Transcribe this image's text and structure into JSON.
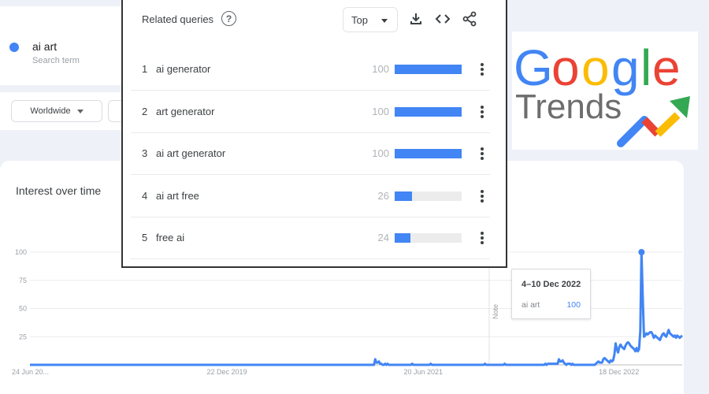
{
  "search_term": {
    "name": "ai art",
    "subtitle": "Search term",
    "color": "#4285f4"
  },
  "filters": {
    "region": "Worldwide"
  },
  "related_queries": {
    "title": "Related queries",
    "help_icon": "help-circle-icon",
    "sort_select": "Top",
    "toolbar_icons": [
      "download-icon",
      "embed-code-icon",
      "share-icon"
    ],
    "items": [
      {
        "rank": "1",
        "query": "ai generator",
        "value": 100
      },
      {
        "rank": "2",
        "query": "art generator",
        "value": 100
      },
      {
        "rank": "3",
        "query": "ai art generator",
        "value": 100
      },
      {
        "rank": "4",
        "query": "ai art free",
        "value": 26
      },
      {
        "rank": "5",
        "query": "free ai",
        "value": 24
      }
    ]
  },
  "logo": {
    "word1": "Google",
    "word2": "Trends"
  },
  "interest_over_time": {
    "title": "Interest over time",
    "tooltip": {
      "date": "4–10 Dec 2022",
      "term": "ai art",
      "value": "100"
    },
    "note_label": "Note"
  },
  "chart_data": {
    "type": "line",
    "title": "Interest over time",
    "xlabel": "",
    "ylabel": "",
    "ylim": [
      0,
      100
    ],
    "yticks": [
      25,
      50,
      75,
      100
    ],
    "xtick_labels": [
      "24 Jun 20...",
      "22 Dec 2019",
      "20 Jun 2021",
      "18 Dec 2022"
    ],
    "grid": true,
    "legend": "none",
    "series": [
      {
        "name": "ai art",
        "color": "#4285f4",
        "values": [
          0,
          0,
          0,
          0,
          0,
          0,
          0,
          0,
          0,
          0,
          0,
          0,
          0,
          0,
          0,
          0,
          0,
          0,
          0,
          0,
          0,
          0,
          0,
          0,
          0,
          0,
          0,
          0,
          0,
          0,
          0,
          0,
          0,
          0,
          0,
          0,
          0,
          0,
          0,
          0,
          0,
          0,
          0,
          0,
          0,
          0,
          0,
          0,
          0,
          0,
          0,
          0,
          0,
          0,
          0,
          0,
          0,
          0,
          0,
          0,
          0,
          0,
          0,
          0,
          0,
          0,
          0,
          0,
          0,
          0,
          0,
          0,
          0,
          0,
          0,
          0,
          0,
          0,
          0,
          0,
          0,
          0,
          0,
          0,
          0,
          0,
          0,
          0,
          0,
          0,
          0,
          0,
          0,
          0,
          0,
          0,
          0,
          0,
          0,
          0,
          0,
          0,
          0,
          0,
          0,
          0,
          0,
          0,
          0,
          0,
          0,
          0,
          0,
          0,
          0,
          0,
          0,
          0,
          0,
          0,
          0,
          0,
          0,
          0,
          0,
          0,
          0,
          0,
          0,
          0,
          0,
          0,
          0,
          0,
          0,
          0,
          0,
          0,
          0,
          0,
          0,
          0,
          0,
          0,
          0,
          0,
          0,
          0,
          0,
          0,
          0,
          0,
          0,
          0,
          0,
          0,
          0,
          0,
          0,
          0,
          0,
          0,
          0,
          0,
          0,
          0,
          0,
          0,
          0,
          0,
          0,
          0,
          0,
          0,
          0,
          0,
          0,
          0,
          0,
          0,
          0,
          0,
          0,
          0,
          0,
          0,
          0,
          0,
          0,
          0,
          0,
          0,
          0,
          0,
          0,
          0,
          0,
          0,
          0,
          0,
          0,
          0,
          0,
          0,
          0,
          0,
          0,
          0,
          0,
          0,
          0,
          0,
          0,
          0,
          0,
          0,
          0,
          0,
          0,
          0,
          0,
          0,
          0,
          0,
          0,
          0,
          0,
          0,
          0,
          0,
          0,
          0,
          0,
          0,
          0,
          0,
          0,
          0,
          0,
          0,
          0,
          0,
          0,
          0,
          0,
          0,
          0,
          0,
          0,
          0,
          0,
          0,
          0,
          0,
          0,
          0,
          0,
          0,
          0,
          0,
          0,
          0,
          0,
          0,
          0,
          0,
          0,
          0,
          0,
          0,
          0,
          0,
          0,
          0,
          0,
          0,
          0,
          0,
          0,
          0,
          5,
          2,
          2,
          3,
          1,
          1,
          0,
          0,
          1,
          0,
          1,
          0,
          0,
          0,
          0,
          0,
          0,
          0,
          0,
          0,
          0,
          0,
          0,
          0,
          0,
          0,
          0,
          0,
          0,
          0,
          1,
          0,
          0,
          0,
          0,
          0,
          0,
          0,
          0,
          0,
          0,
          0,
          0,
          0,
          0,
          1,
          0,
          0,
          0,
          0,
          0,
          0,
          0,
          0,
          0,
          0,
          0,
          0,
          0,
          0,
          0,
          0,
          0,
          0,
          0,
          0,
          0,
          0,
          0,
          0,
          0,
          0,
          0,
          0,
          0,
          0,
          0,
          0,
          0,
          0,
          0,
          0,
          0,
          0,
          0,
          0,
          0,
          0,
          0,
          1,
          0,
          0,
          0,
          0,
          0,
          0,
          0,
          0,
          0,
          0,
          0,
          0,
          0,
          0,
          0,
          1,
          0,
          0,
          0,
          0,
          0,
          0,
          0,
          0,
          0,
          0,
          0,
          0,
          0,
          0,
          0,
          0,
          0,
          0,
          0,
          0,
          0,
          0,
          0,
          0,
          0,
          0,
          0,
          0,
          0,
          0,
          0,
          0,
          1,
          0,
          1,
          1,
          1,
          1,
          1,
          1,
          1,
          1,
          1,
          5,
          3,
          3,
          4,
          2,
          1,
          0,
          1,
          1,
          1,
          0,
          1,
          0,
          0,
          0,
          0,
          0,
          0,
          0,
          0,
          0,
          0,
          0,
          0,
          0,
          0,
          0,
          0,
          0,
          0,
          1,
          2,
          3,
          2,
          2,
          2,
          5,
          6,
          5,
          4,
          3,
          2,
          4,
          3,
          4,
          9,
          19,
          14,
          11,
          16,
          18,
          16,
          15,
          14,
          17,
          19,
          20,
          19,
          17,
          16,
          15,
          14,
          12,
          15,
          12,
          14,
          30,
          100,
          60,
          25,
          26,
          28,
          27,
          28,
          29,
          29,
          27,
          24,
          26,
          25,
          24,
          23,
          22,
          25,
          27,
          28,
          26,
          25,
          28,
          31,
          28,
          27,
          26,
          25,
          26,
          24,
          26,
          25,
          24,
          25,
          26
        ]
      }
    ]
  }
}
